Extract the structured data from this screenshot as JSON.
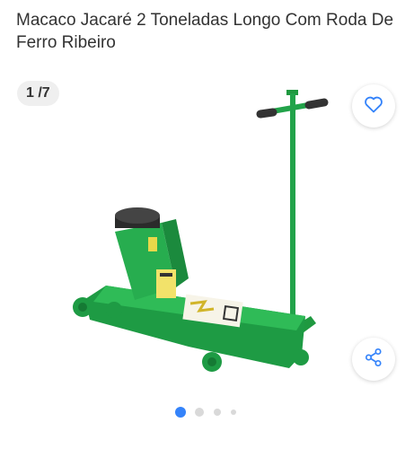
{
  "product": {
    "title": "Macaco Jacaré 2 Toneladas Longo Com Roda De Ferro Ribeiro"
  },
  "gallery": {
    "counter": "1 /7",
    "total_images": 7,
    "active_index": 0
  },
  "icons": {
    "favorite": "heart-icon",
    "share": "share-icon"
  },
  "colors": {
    "accent": "#3483fa",
    "jack_green": "#22a34a",
    "dot_inactive": "#d9d9d9"
  }
}
